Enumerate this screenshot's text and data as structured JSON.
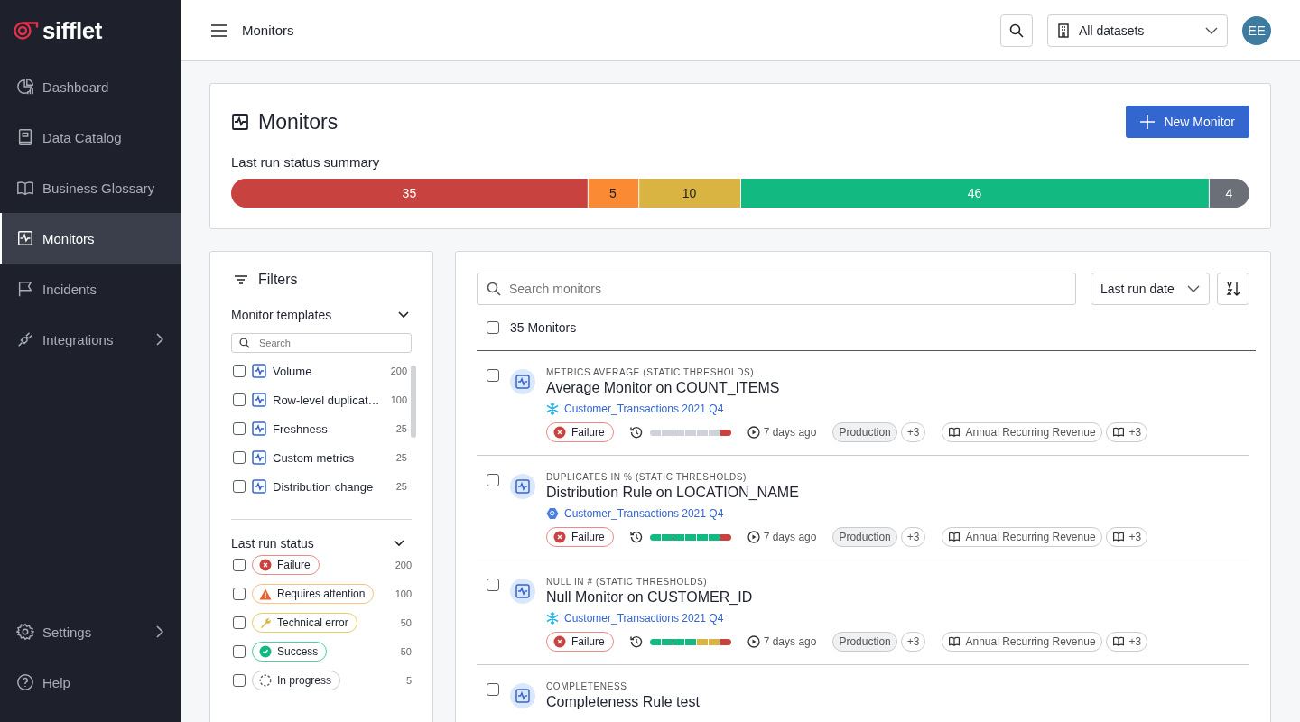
{
  "brand": "sifflet",
  "sidebar": {
    "items": [
      {
        "label": "Dashboard",
        "selected": false,
        "submenu": false
      },
      {
        "label": "Data Catalog",
        "selected": false,
        "submenu": false
      },
      {
        "label": "Business Glossary",
        "selected": false,
        "submenu": false
      },
      {
        "label": "Monitors",
        "selected": true,
        "submenu": false
      },
      {
        "label": "Incidents",
        "selected": false,
        "submenu": false
      },
      {
        "label": "Integrations",
        "selected": false,
        "submenu": true
      }
    ],
    "bottom_items": [
      {
        "label": "Settings",
        "selected": false,
        "submenu": true
      },
      {
        "label": "Help",
        "selected": false,
        "submenu": false
      }
    ]
  },
  "topbar": {
    "title": "Monitors",
    "dataset_select": "All datasets",
    "avatar": "EE"
  },
  "summary": {
    "title": "Monitors",
    "new_button": "New Monitor",
    "chart_data": {
      "type": "bar",
      "orientation": "horizontal",
      "stacked": true,
      "title": "Last run status summary",
      "data_labels": true,
      "series": [
        {
          "color": "#c8423f",
          "values": [
            35
          ]
        },
        {
          "color": "#fb8a35",
          "values": [
            5
          ]
        },
        {
          "color": "#d9b443",
          "values": [
            10
          ]
        },
        {
          "color": "#12b981",
          "values": [
            46
          ]
        },
        {
          "color": "#6b6f78",
          "values": [
            4
          ]
        }
      ]
    }
  },
  "filters": {
    "title": "Filters",
    "templates": {
      "title": "Monitor templates",
      "expanded": true,
      "search_placeholder": "Search",
      "items": [
        {
          "label": "Volume",
          "count": "200",
          "checked": false
        },
        {
          "label": "Row-level duplicat…",
          "count": "100",
          "checked": false
        },
        {
          "label": "Freshness",
          "count": "25",
          "checked": false
        },
        {
          "label": "Custom metrics",
          "count": "25",
          "checked": false
        },
        {
          "label": "Distribution change",
          "count": "25",
          "checked": false
        }
      ]
    },
    "statuses": {
      "title": "Last run status",
      "expanded": true,
      "items": [
        {
          "label": "Failure",
          "kind": "failure",
          "count": "200",
          "checked": false
        },
        {
          "label": "Requires attention",
          "kind": "attention",
          "count": "100",
          "checked": false
        },
        {
          "label": "Technical error",
          "kind": "technical",
          "count": "50",
          "checked": false
        },
        {
          "label": "Success",
          "kind": "success",
          "count": "50",
          "checked": false
        },
        {
          "label": "In progress",
          "kind": "progress",
          "count": "5",
          "checked": false
        }
      ]
    }
  },
  "list": {
    "search_placeholder": "Search monitors",
    "sort_select": "Last run date",
    "count_label": "35 Monitors",
    "select_all": false,
    "monitors": [
      {
        "type": "METRICS AVERAGE (STATIC THRESHOLDS)",
        "title": "Average Monitor on COUNT_ITEMS",
        "dataset": {
          "kind": "snowflake",
          "name": "Customer_Transactions 2021 Q4"
        },
        "checked": false,
        "kind": "failure",
        "status_label": "Failure",
        "history": [
          {
            "color": "#cfd2d8"
          },
          {
            "color": "#cfd2d8"
          },
          {
            "color": "#cfd2d8"
          },
          {
            "color": "#cfd2d8"
          },
          {
            "color": "#cfd2d8"
          },
          {
            "color": "#cfd2d8"
          },
          {
            "color": "#c8423f"
          }
        ],
        "last_run": "7 days ago",
        "tag": "Production",
        "tag_more": "+3",
        "term": "Annual Recurring Revenue",
        "term_more": "+3"
      },
      {
        "type": "DUPLICATES IN % (STATIC THRESHOLDS)",
        "title": "Distribution Rule on LOCATION_NAME",
        "dataset": {
          "kind": "bigquery",
          "name": "Customer_Transactions 2021 Q4"
        },
        "checked": false,
        "kind": "failure",
        "status_label": "Failure",
        "history": [
          {
            "color": "#12b981"
          },
          {
            "color": "#12b981"
          },
          {
            "color": "#12b981"
          },
          {
            "color": "#12b981"
          },
          {
            "color": "#12b981"
          },
          {
            "color": "#12b981"
          },
          {
            "color": "#c8423f"
          }
        ],
        "last_run": "7 days ago",
        "tag": "Production",
        "tag_more": "+3",
        "term": "Annual Recurring Revenue",
        "term_more": "+3"
      },
      {
        "type": "NULL IN # (STATIC THRESHOLDS)",
        "title": "Null Monitor on CUSTOMER_ID",
        "dataset": {
          "kind": "snowflake",
          "name": "Customer_Transactions 2021 Q4"
        },
        "checked": false,
        "kind": "failure",
        "status_label": "Failure",
        "history": [
          {
            "color": "#12b981"
          },
          {
            "color": "#12b981"
          },
          {
            "color": "#12b981"
          },
          {
            "color": "#12b981"
          },
          {
            "color": "#d9b443"
          },
          {
            "color": "#d9b443"
          },
          {
            "color": "#c8423f"
          }
        ],
        "last_run": "7 days ago",
        "tag": "Production",
        "tag_more": "+3",
        "term": "Annual Recurring Revenue",
        "term_more": "+3"
      },
      {
        "type": "COMPLETENESS",
        "title": "Completeness Rule test",
        "checked": false
      }
    ]
  }
}
